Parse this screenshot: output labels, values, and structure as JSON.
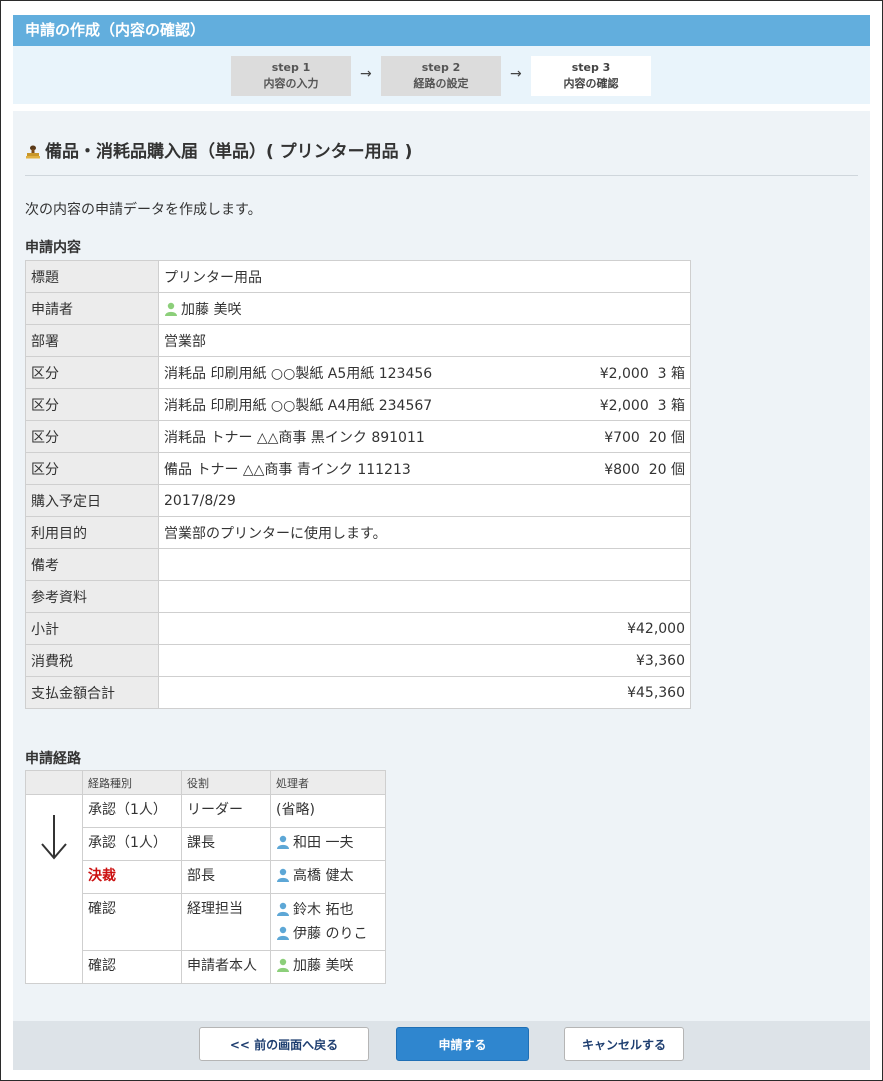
{
  "header": {
    "title": "申請の作成（内容の確認）"
  },
  "steps": [
    {
      "num": "step 1",
      "label": "内容の入力"
    },
    {
      "num": "step 2",
      "label": "経路の設定"
    },
    {
      "num": "step 3",
      "label": "内容の確認"
    }
  ],
  "arrow_glyph": "→",
  "form": {
    "title": "備品・消耗品購入届（単品）( プリンター用品 )",
    "intro": "次の内容の申請データを作成します。",
    "content_heading": "申請内容",
    "fields": {
      "subject": {
        "label": "標題",
        "value": "プリンター用品"
      },
      "applicant": {
        "label": "申請者",
        "value": "加藤 美咲"
      },
      "department": {
        "label": "部署",
        "value": "営業部"
      },
      "items": [
        {
          "label": "区分",
          "desc": "消耗品 印刷用紙 ○○製紙 A5用紙 123456",
          "price": "¥2,000",
          "qty": "3 箱"
        },
        {
          "label": "区分",
          "desc": "消耗品 印刷用紙 ○○製紙 A4用紙 234567",
          "price": "¥2,000",
          "qty": "3 箱"
        },
        {
          "label": "区分",
          "desc": "消耗品 トナー △△商事 黒インク 891011",
          "price": "¥700",
          "qty": "20 個"
        },
        {
          "label": "区分",
          "desc": "備品 トナー △△商事 青インク 111213",
          "price": "¥800",
          "qty": "20 個"
        }
      ],
      "purchase_date": {
        "label": "購入予定日",
        "value": "2017/8/29"
      },
      "purpose": {
        "label": "利用目的",
        "value": "営業部のプリンターに使用します。"
      },
      "remarks": {
        "label": "備考",
        "value": ""
      },
      "reference": {
        "label": "参考資料",
        "value": ""
      },
      "subtotal": {
        "label": "小計",
        "value": "¥42,000"
      },
      "tax": {
        "label": "消費税",
        "value": "¥3,360"
      },
      "total": {
        "label": "支払金額合計",
        "value": "¥45,360"
      }
    }
  },
  "route": {
    "heading": "申請経路",
    "arrow": "↓",
    "columns": [
      "経路種別",
      "役割",
      "処理者"
    ],
    "rows": [
      {
        "type": "承認（1人）",
        "role": "リーダー",
        "persons": [
          "(省略)"
        ]
      },
      {
        "type": "承認（1人）",
        "role": "課長",
        "persons": [
          "和田 一夫"
        ]
      },
      {
        "type": "決裁",
        "role": "部長",
        "persons": [
          "高橋 健太"
        ]
      },
      {
        "type": "確認",
        "role": "経理担当",
        "persons": [
          "鈴木 拓也",
          "伊藤 のりこ"
        ]
      },
      {
        "type": "確認",
        "role": "申請者本人",
        "persons": [
          "加藤 美咲"
        ]
      }
    ]
  },
  "buttons": {
    "back": "<< 前の画面へ戻る",
    "submit": "申請する",
    "cancel": "キャンセルする"
  },
  "colors": {
    "header": "#62aedd",
    "primary_button": "#2f86cf",
    "kessai": "#cc1111"
  },
  "icons": {
    "title": "stamp-icon",
    "user": "user-icon"
  }
}
